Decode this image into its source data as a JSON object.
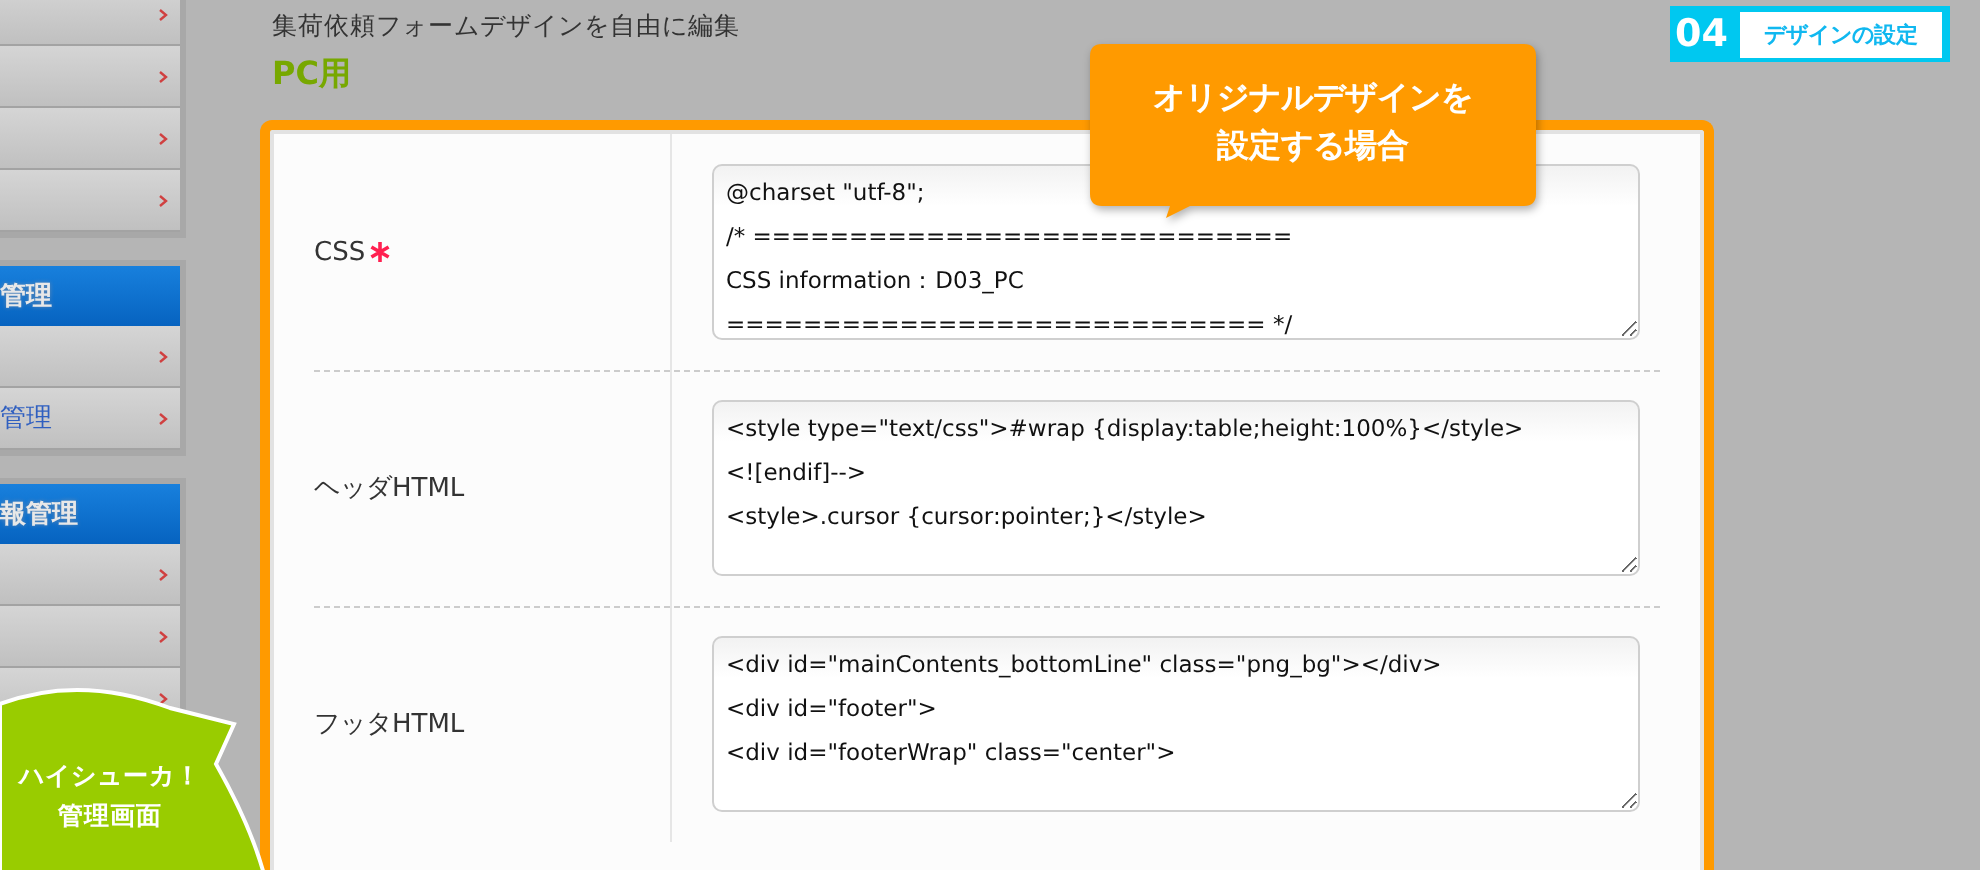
{
  "sidebar": {
    "groups": [
      {
        "items": [
          {
            "kind": "link"
          },
          {
            "kind": "link"
          },
          {
            "kind": "link"
          },
          {
            "kind": "link"
          }
        ]
      },
      {
        "items": [
          {
            "kind": "header",
            "label": "管理"
          },
          {
            "kind": "link"
          },
          {
            "kind": "link",
            "label": "管理"
          }
        ]
      },
      {
        "items": [
          {
            "kind": "header",
            "label": "報管理"
          },
          {
            "kind": "link"
          },
          {
            "kind": "link"
          },
          {
            "kind": "link"
          }
        ]
      }
    ]
  },
  "mascot_bubble": {
    "lines": [
      "ハイシューカ！",
      "管理画面"
    ]
  },
  "page": {
    "subtitle": "集荷依頼フォームデザインを自由に編集",
    "heading": "PC用"
  },
  "step_badge": {
    "number": "04",
    "label": "デザインの設定"
  },
  "callout": {
    "lines": [
      "オリジナルデザインを",
      "設定する場合"
    ]
  },
  "form": {
    "rows": [
      {
        "label": "CSS",
        "required": true,
        "value": "@charset \"utf-8\";\n/* ============================\nCSS information：D03_PC\n============================ */"
      },
      {
        "label": "ヘッダHTML",
        "required": false,
        "value": "<style type=\"text/css\">#wrap {display:table;height:100%}</style>\n<![endif]-->\n<style>.cursor {cursor:pointer;}</style>"
      },
      {
        "label": "フッタHTML",
        "required": false,
        "value": "<div id=\"mainContents_bottomLine\" class=\"png_bg\"></div>\n<div id=\"footer\">\n<div id=\"footerWrap\" class=\"center\">"
      }
    ]
  }
}
